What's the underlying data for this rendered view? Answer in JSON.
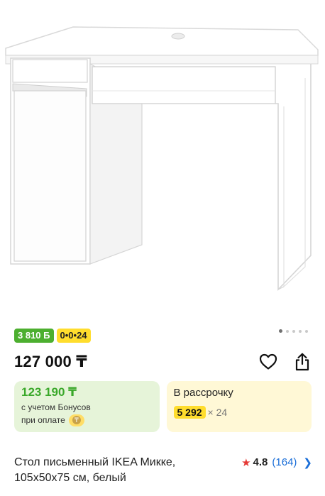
{
  "product": {
    "title_line1": "Стол письменный IKEA Микке,",
    "title_line2": "105x50x75 см, белый",
    "price": "127 000 ₸"
  },
  "badges": {
    "bonus": "3 810 Б",
    "installment": "0•0•24"
  },
  "gallery": {
    "dots": [
      true,
      false,
      false,
      false,
      false
    ]
  },
  "bonus_card": {
    "price": "123 190 ₸",
    "note_line1": "с учетом Бонусов",
    "note_line2": "при оплате"
  },
  "installment_card": {
    "title": "В рассрочку",
    "amount": "5 292",
    "times": "× 24"
  },
  "rating": {
    "value": "4.8",
    "count": "(164)"
  },
  "colors": {
    "bonus_green": "#4caf2f",
    "installment_yellow": "#ffdd2d",
    "rating_star": "#e53935",
    "link_blue": "#1a6ed8"
  },
  "icons": {
    "favorite": "heart-icon",
    "share": "share-icon",
    "rating": "star-icon",
    "more": "chevron-right-icon"
  }
}
